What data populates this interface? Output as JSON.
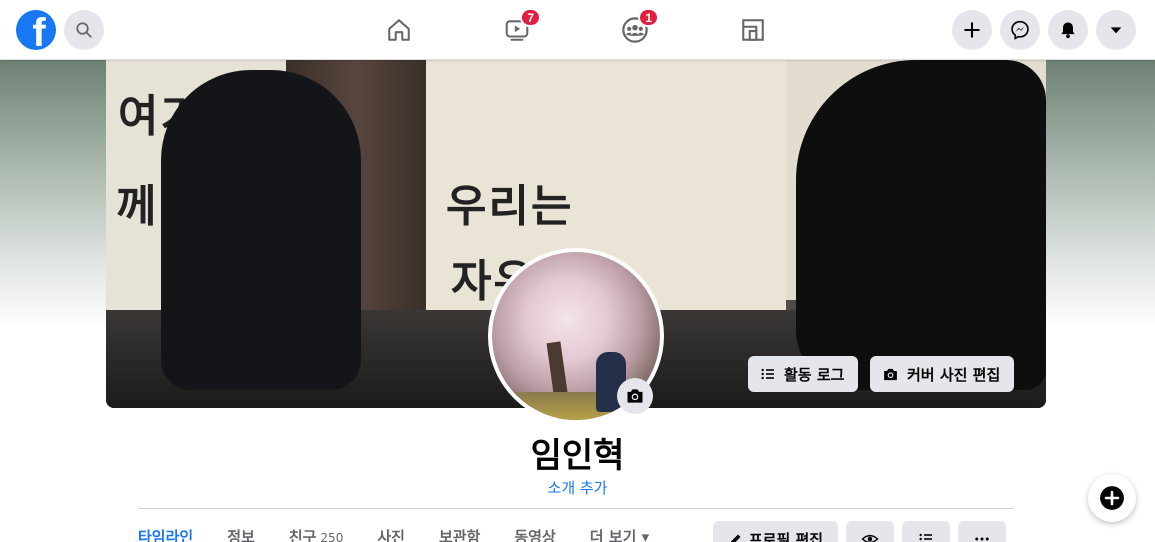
{
  "topbar": {
    "logo_letter": "f",
    "nav": {
      "home_icon": "home-icon",
      "watch_badge": "7",
      "groups_badge": "1",
      "gaming_icon": "gaming-icon"
    },
    "right_icons": [
      "plus-icon",
      "messenger-icon",
      "notifications-icon",
      "dropdown-icon"
    ]
  },
  "cover": {
    "mural_text": [
      "여기",
      "께이",
      "우리는",
      "자유"
    ],
    "activity_log_label": "활동 로그",
    "edit_cover_label": "커버 사진 편집"
  },
  "profile": {
    "name": "임인혁",
    "add_bio": "소개 추가"
  },
  "tabs": [
    {
      "label": "타임라인",
      "active": true
    },
    {
      "label": "정보"
    },
    {
      "label": "친구",
      "count": "250"
    },
    {
      "label": "사진"
    },
    {
      "label": "보관함"
    },
    {
      "label": "동영상"
    },
    {
      "label": "더 보기 ▾"
    }
  ],
  "actions": {
    "edit_profile_label": "프로필 편집"
  },
  "colors": {
    "accent": "#1877f2",
    "badge": "#e41e3f",
    "button_bg": "#e4e6eb"
  }
}
